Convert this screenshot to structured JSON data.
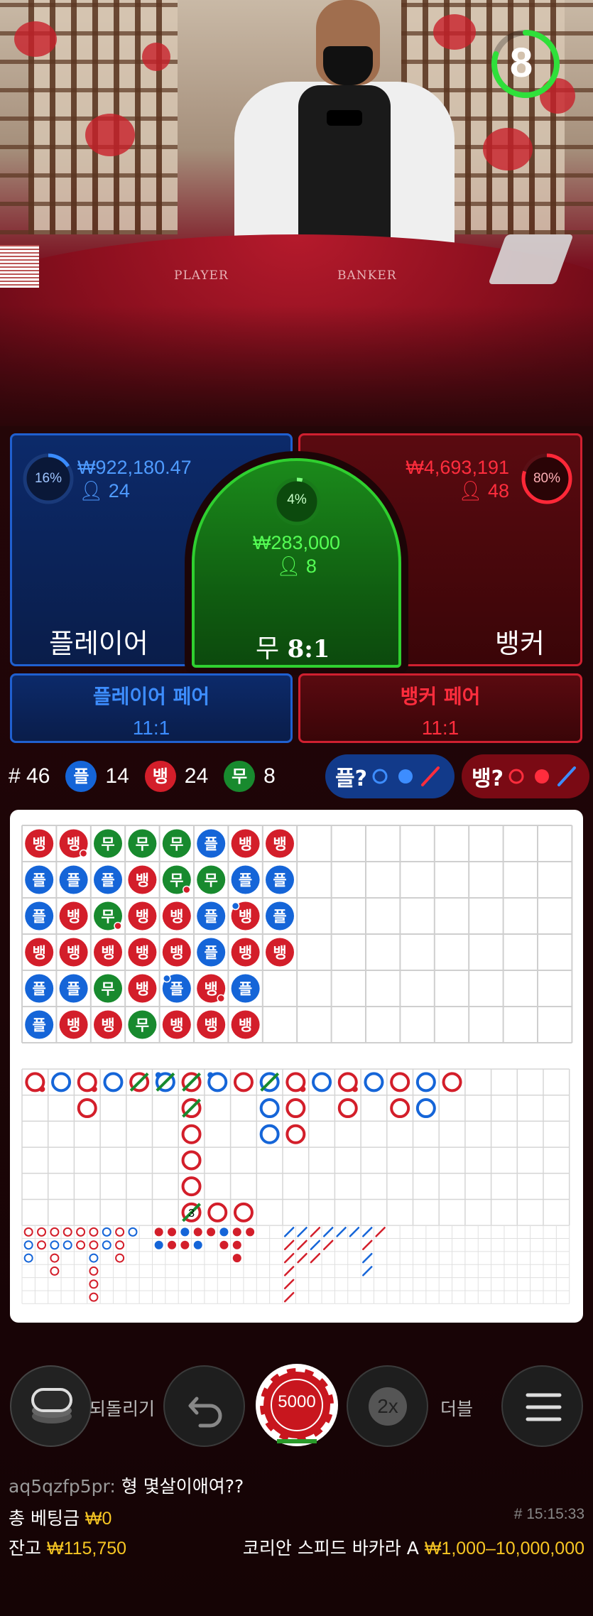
{
  "timer": {
    "value": "8",
    "progress": 0.8
  },
  "table_text": {
    "player": "PLAYER",
    "banker": "BANKER"
  },
  "player": {
    "amount": "₩922,180.47",
    "players": "24",
    "pct": "16%",
    "pct_value": 0.16,
    "label": "플레이어"
  },
  "tie": {
    "amount": "₩283,000",
    "players": "8",
    "pct": "4%",
    "pct_value": 0.04,
    "label": "무",
    "odds": "8:1"
  },
  "banker": {
    "amount": "₩4,693,191",
    "players": "48",
    "pct": "80%",
    "pct_value": 0.8,
    "label": "뱅커"
  },
  "pairs": {
    "player": {
      "label": "플레이어 페어",
      "odds": "11:1"
    },
    "banker": {
      "label": "뱅커 페어",
      "odds": "11:1"
    }
  },
  "stats": {
    "round": "# 46",
    "player_symbol": "플",
    "player_count": "14",
    "banker_symbol": "뱅",
    "banker_count": "24",
    "tie_symbol": "무",
    "tie_count": "8",
    "predict_player": "플?",
    "predict_banker": "뱅?"
  },
  "colors": {
    "player": "#1565d8",
    "banker": "#d31e2a",
    "tie": "#188a2e",
    "gold": "#f7c623"
  },
  "bead_road": [
    [
      {
        "s": "B"
      },
      {
        "s": "P"
      },
      {
        "s": "P"
      },
      {
        "s": "B"
      },
      {
        "s": "P"
      },
      {
        "s": "P"
      }
    ],
    [
      {
        "s": "B",
        "bp": true
      },
      {
        "s": "P"
      },
      {
        "s": "B"
      },
      {
        "s": "B"
      },
      {
        "s": "P"
      },
      {
        "s": "B"
      }
    ],
    [
      {
        "s": "T"
      },
      {
        "s": "P"
      },
      {
        "s": "T",
        "bp": true
      },
      {
        "s": "B"
      },
      {
        "s": "T"
      },
      {
        "s": "B"
      }
    ],
    [
      {
        "s": "T"
      },
      {
        "s": "B"
      },
      {
        "s": "B"
      },
      {
        "s": "B"
      },
      {
        "s": "B"
      },
      {
        "s": "T"
      }
    ],
    [
      {
        "s": "T"
      },
      {
        "s": "T",
        "bp": true
      },
      {
        "s": "B"
      },
      {
        "s": "B"
      },
      {
        "s": "P",
        "pp": true
      },
      {
        "s": "B"
      }
    ],
    [
      {
        "s": "P"
      },
      {
        "s": "T"
      },
      {
        "s": "P"
      },
      {
        "s": "P"
      },
      {
        "s": "B",
        "bp": true
      },
      {
        "s": "B"
      }
    ],
    [
      {
        "s": "B"
      },
      {
        "s": "P"
      },
      {
        "s": "B",
        "pp": true
      },
      {
        "s": "B"
      },
      {
        "s": "P"
      },
      {
        "s": "B"
      }
    ],
    [
      {
        "s": "B"
      },
      {
        "s": "P"
      },
      {
        "s": "P"
      },
      {
        "s": "B"
      },
      null,
      null
    ]
  ],
  "big_road": [
    [
      {
        "c": "B",
        "bp": true
      }
    ],
    [
      {
        "c": "P"
      }
    ],
    [
      {
        "c": "B",
        "bp": true
      },
      {
        "c": "B"
      }
    ],
    [
      {
        "c": "P"
      }
    ],
    [
      {
        "c": "B",
        "tie": true
      }
    ],
    [
      {
        "c": "P",
        "tie": true,
        "pp": true
      }
    ],
    [
      {
        "c": "B",
        "tie": true
      },
      {
        "c": "B",
        "tie": true
      },
      {
        "c": "B"
      },
      {
        "c": "B"
      },
      {
        "c": "B"
      },
      {
        "c": "B",
        "tie": true,
        "n": "3"
      }
    ],
    [
      {
        "c": "P",
        "pp": true
      }
    ],
    [
      {
        "c": "B"
      }
    ],
    [
      {
        "c": "P",
        "tie": true
      },
      {
        "c": "P"
      },
      {
        "c": "P"
      }
    ],
    [
      {
        "c": "B",
        "bp": true
      },
      {
        "c": "B"
      },
      {
        "c": "B"
      }
    ],
    [
      {
        "c": "P"
      }
    ],
    [
      {
        "c": "B",
        "bp": true
      },
      {
        "c": "B"
      }
    ],
    [
      {
        "c": "P"
      }
    ],
    [
      {
        "c": "B"
      },
      {
        "c": "B"
      }
    ],
    [
      {
        "c": "P"
      },
      {
        "c": "P"
      }
    ],
    [
      {
        "c": "B"
      }
    ]
  ],
  "big_road_tail": [
    {
      "col": 7,
      "row": 5,
      "c": "B"
    },
    {
      "col": 8,
      "row": 5,
      "c": "B"
    }
  ],
  "controls": {
    "undo_label": "되돌리기",
    "chip_value": "5000",
    "double_badge": "2x",
    "double_label": "더블"
  },
  "chat": {
    "user": "aq5qzfp5pr:",
    "message": "형 몇살이애여??"
  },
  "footer": {
    "total_bet_label": "총 베팅금",
    "total_bet_value": "₩0",
    "round_id": "# 15:15:33",
    "balance_label": "잔고",
    "balance_value": "₩115,750",
    "table_name": "코리안 스피드 바카라 A",
    "limits": "₩1,000–10,000,000"
  }
}
